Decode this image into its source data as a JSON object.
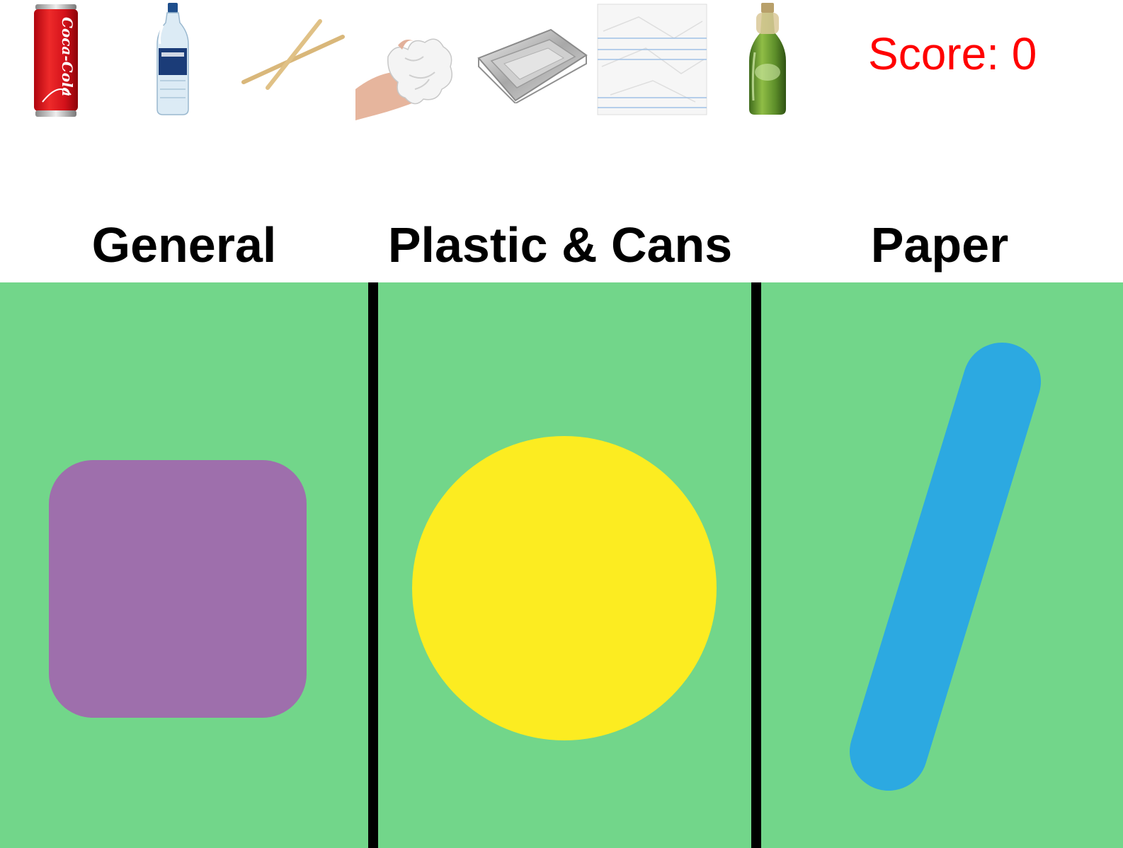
{
  "score": {
    "label": "Score: 0",
    "color": "#ff0000"
  },
  "items": [
    {
      "name": "coca-cola-can",
      "icon": "soda-can-icon",
      "brand_text": "Coca-Cola"
    },
    {
      "name": "water-bottle",
      "icon": "plastic-bottle-icon"
    },
    {
      "name": "wooden-chopsticks",
      "icon": "chopsticks-icon"
    },
    {
      "name": "used-tissue",
      "icon": "tissue-icon"
    },
    {
      "name": "aluminium-tray",
      "icon": "foil-tray-icon"
    },
    {
      "name": "lined-paper",
      "icon": "paper-sheet-icon"
    },
    {
      "name": "glass-bottle",
      "icon": "glass-bottle-icon"
    }
  ],
  "bins": [
    {
      "id": "general",
      "label": "General",
      "shape": "rounded-square",
      "shape_color": "#9e6fac"
    },
    {
      "id": "plastic-cans",
      "label": "Plastic & Cans",
      "shape": "circle",
      "shape_color": "#fcec21"
    },
    {
      "id": "paper",
      "label": "Paper",
      "shape": "slash",
      "shape_color": "#2ca9e1"
    }
  ],
  "colors": {
    "bin_background": "#72d68a",
    "divider": "#000000",
    "page_background": "#ffffff"
  }
}
